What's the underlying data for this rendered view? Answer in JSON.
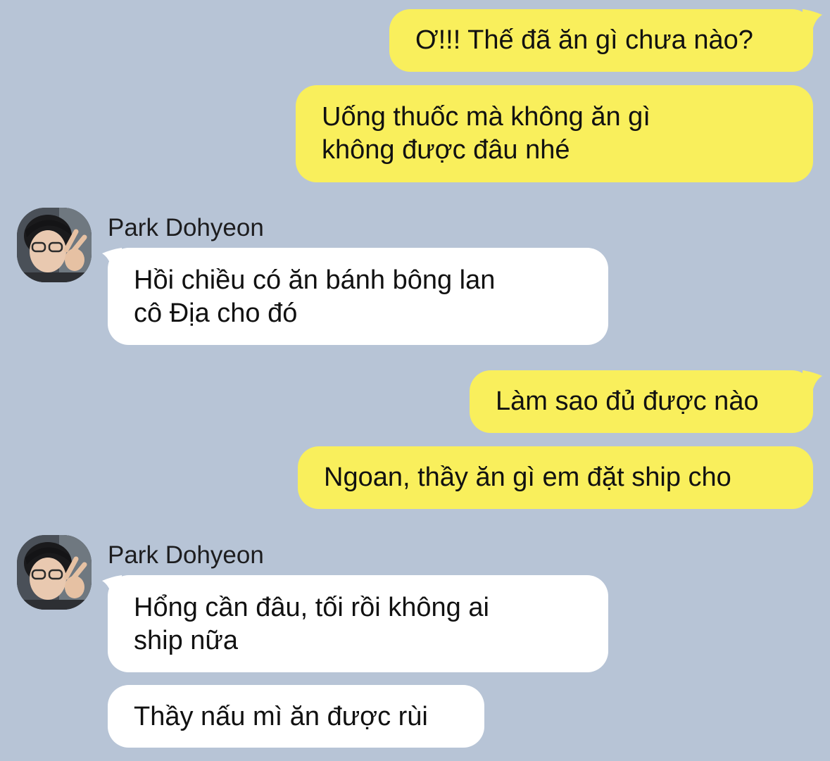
{
  "colors": {
    "background": "#b7c4d6",
    "outgoing_bubble": "#f9ef5c",
    "incoming_bubble": "#ffffff",
    "text": "#111111"
  },
  "messages": [
    {
      "direction": "outgoing",
      "lines": [
        "Ơ!!! Thế đã ăn gì chưa nào?"
      ]
    },
    {
      "direction": "outgoing",
      "lines": [
        "Uống thuốc mà không ăn gì",
        "không được đâu nhé"
      ]
    },
    {
      "direction": "incoming",
      "sender": "Park Dohyeon",
      "avatar_icon": "profile-photo-avatar",
      "lines": [
        "Hồi chiều có ăn bánh bông lan",
        "cô Địa cho đó"
      ]
    },
    {
      "direction": "outgoing",
      "lines": [
        "Làm sao đủ được nào"
      ]
    },
    {
      "direction": "outgoing",
      "lines": [
        "Ngoan, thầy ăn gì em đặt ship cho"
      ]
    },
    {
      "direction": "incoming",
      "sender": "Park Dohyeon",
      "avatar_icon": "profile-photo-avatar",
      "lines": [
        "Hổng cần đâu, tối rồi không ai",
        "ship nữa"
      ]
    },
    {
      "direction": "incoming",
      "lines": [
        "Thầy nấu mì ăn được rùi"
      ]
    }
  ]
}
